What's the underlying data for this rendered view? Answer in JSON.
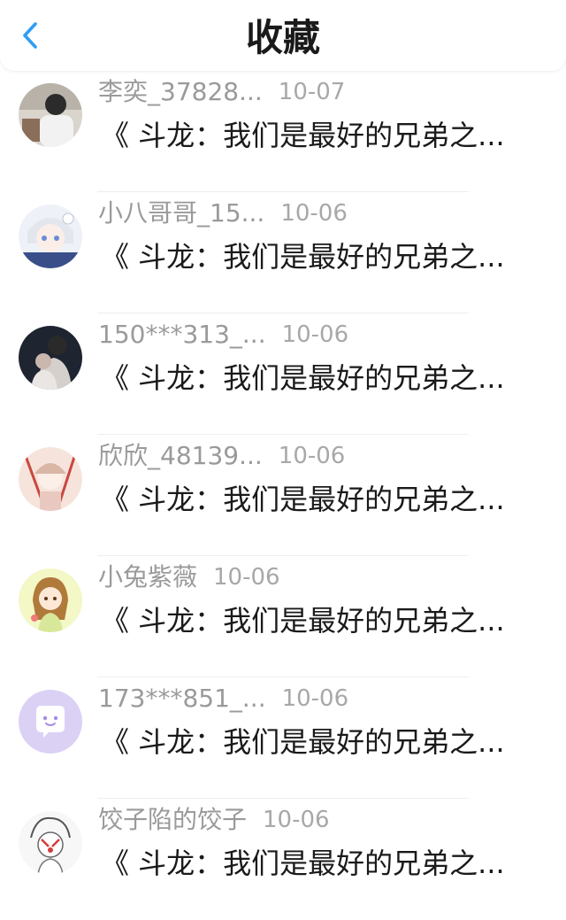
{
  "header": {
    "title": "收藏",
    "back_icon": "chevron-left-icon",
    "accent_color": "#2f9df4"
  },
  "items": [
    {
      "username": "李奕_37828...",
      "date": "10-07",
      "title": "《 斗龙：我们是最好的兄弟之...",
      "avatar": "photo-avatar"
    },
    {
      "username": "小八哥哥_15...",
      "date": "10-06",
      "title": "《 斗龙：我们是最好的兄弟之...",
      "avatar": "anime-avatar"
    },
    {
      "username": "150***313_...",
      "date": "10-06",
      "title": "《 斗龙：我们是最好的兄弟之...",
      "avatar": "photo-avatar"
    },
    {
      "username": "欣欣_48139...",
      "date": "10-06",
      "title": "《 斗龙：我们是最好的兄弟之...",
      "avatar": "anime-avatar"
    },
    {
      "username": "小兔紫薇",
      "date": "10-06",
      "title": "《 斗龙：我们是最好的兄弟之...",
      "avatar": "anime-avatar"
    },
    {
      "username": "173***851_...",
      "date": "10-06",
      "title": "《 斗龙：我们是最好的兄弟之...",
      "avatar": "default-chat-avatar"
    },
    {
      "username": "饺子陷的饺子",
      "date": "10-06",
      "title": "《 斗龙：我们是最好的兄弟之...",
      "avatar": "anime-avatar"
    }
  ]
}
